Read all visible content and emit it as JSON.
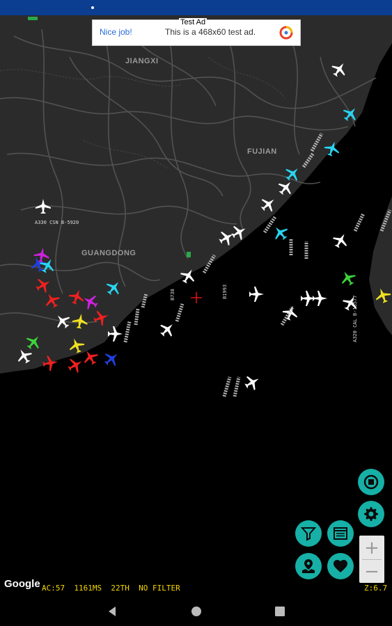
{
  "ad": {
    "label": "Test Ad",
    "headline": "Nice job!",
    "body": "This is a 468x60 test ad.",
    "logo_icon": "admob-icon"
  },
  "map": {
    "regions": [
      "JIANGXI",
      "FUJIAN",
      "GUANGDONG"
    ],
    "land_color": "#2b2b2b",
    "road_color": "#555555",
    "sea_color": "#000000"
  },
  "aircraft": [
    {
      "label": "A330 CSN B-5920",
      "color": "#ffffff"
    },
    {
      "label": "B738",
      "color": "#ffffff"
    },
    {
      "label": "B1993",
      "color": "#ffffff"
    },
    {
      "label": "A320 CAL B-18577",
      "color": "#ffffff"
    }
  ],
  "controls": {
    "record_icon": "record-icon",
    "settings_icon": "gear-icon",
    "filter_icon": "filter-icon",
    "list_icon": "list-window-icon",
    "map_icon": "map-pin-icon",
    "favorite_icon": "heart-icon",
    "accent_color": "#16b0a6"
  },
  "zoom": {
    "in_label": "+",
    "out_label": "−"
  },
  "status": {
    "aircraft_count": "AC:57",
    "latency": "1161MS",
    "threads": "22TH",
    "filter": "NO FILTER",
    "zoom_level": "Z:6.7"
  },
  "attribution": "Google"
}
